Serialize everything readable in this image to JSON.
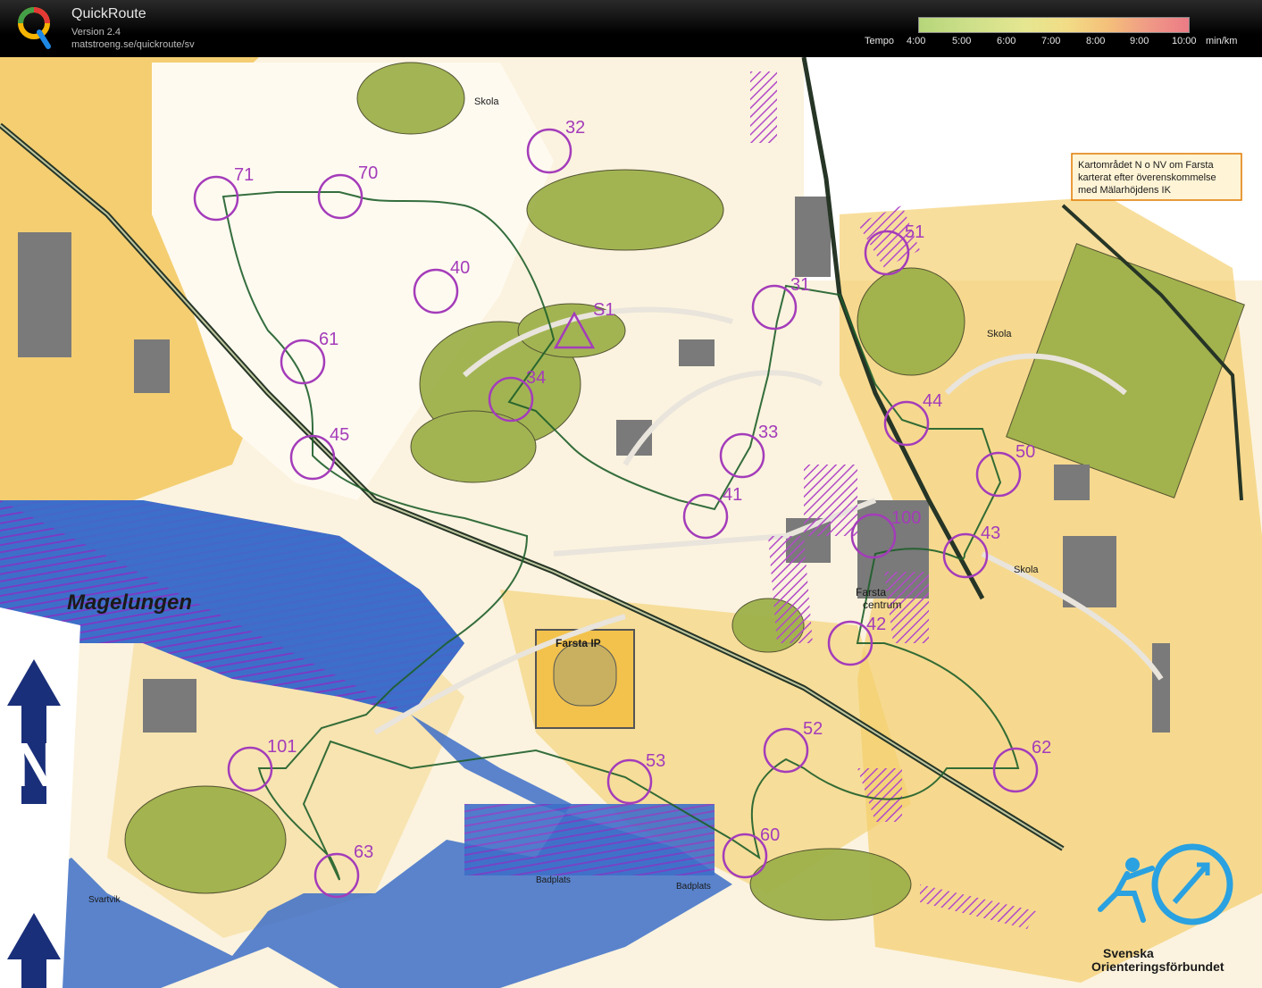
{
  "header": {
    "app_name": "QuickRoute",
    "version": "Version 2.4",
    "url": "matstroeng.se/quickroute/sv",
    "tempo_label": "Tempo",
    "tempo_ticks": [
      "4:00",
      "5:00",
      "6:00",
      "7:00",
      "8:00",
      "9:00",
      "10:00"
    ],
    "tempo_unit": "min/km"
  },
  "map": {
    "lake_name": "Magelungen",
    "stadium_label": "Farsta IP",
    "center_label_1": "Farsta",
    "center_label_2": "centrum",
    "school_labels": [
      "Skola",
      "Skola",
      "Skola"
    ],
    "bath_labels": [
      "Badplats",
      "Badplats"
    ],
    "place_label": "Svartvik",
    "note_lines": [
      "Kartområdet N o NV om Farsta",
      "karterat efter överenskommelse",
      "med Mälarhöjdens IK"
    ],
    "federation_line_1": "Svenska",
    "federation_line_2": "Orienteringsförbundet",
    "start_label": "S1",
    "controls": [
      "71",
      "70",
      "32",
      "40",
      "61",
      "34",
      "45",
      "41",
      "33",
      "31",
      "51",
      "44",
      "50",
      "100",
      "43",
      "42",
      "52",
      "53",
      "101",
      "63",
      "60",
      "62"
    ],
    "colors": {
      "control_circle": "#a43cba",
      "route": "#1e5e2a",
      "water": "#3d6fc9",
      "open_land": "#f2c24c",
      "forest": "#ffffff",
      "settlement": "#9db04a",
      "building": "#7a7a7a",
      "road": "#e9e4dc"
    }
  }
}
